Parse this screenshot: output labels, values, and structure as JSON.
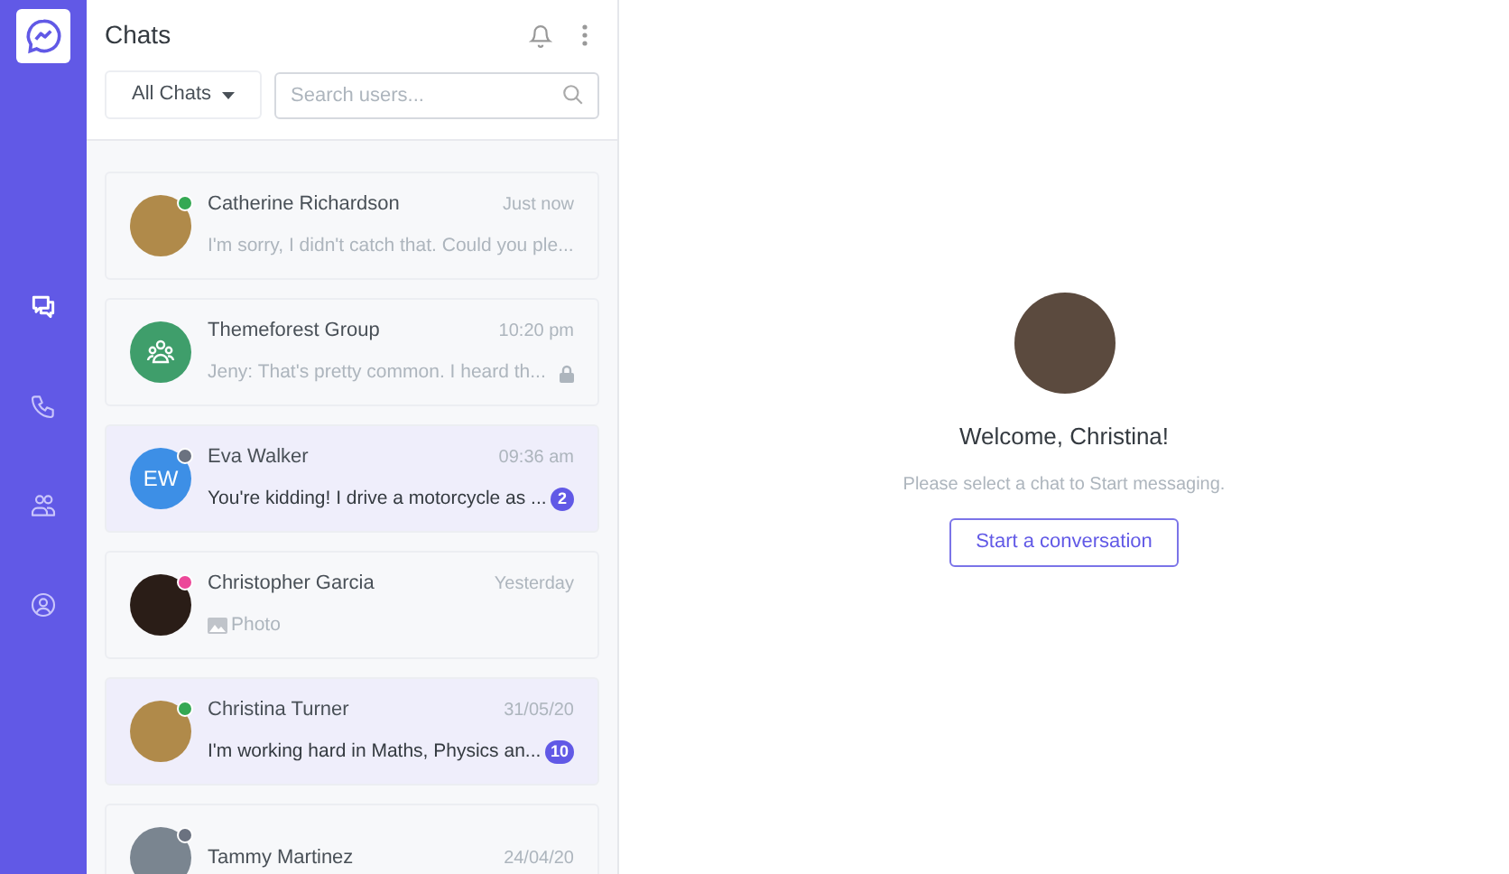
{
  "nav": [
    {
      "selected": true
    },
    {
      "selected": false
    },
    {
      "selected": false
    },
    {
      "selected": false
    }
  ],
  "header": {
    "title": "Chats",
    "filter": "All Chats",
    "search": {
      "placeholder": "Search users..."
    }
  },
  "chats": [
    {
      "name": "Catherine Richardson",
      "time": "Just now",
      "kind": "photo",
      "color": "#34a853",
      "unread": false,
      "message": {
        "kind": "text",
        "text": "I'm sorry, I didn't catch that. Could you ple..."
      }
    },
    {
      "name": "Themeforest Group",
      "time": "10:20 pm",
      "kind": "group",
      "unread": false,
      "locked": true,
      "message": {
        "kind": "text",
        "text": "Jeny: That's pretty common. I heard th..."
      }
    },
    {
      "name": "Eva Walker",
      "time": "09:36 am",
      "kind": "initials",
      "initials": "EW",
      "color": "#6b7280",
      "unread": true,
      "badge": "2",
      "message": {
        "kind": "text",
        "text": "You're kidding! I drive a motorcycle as ..."
      }
    },
    {
      "name": "Christopher Garcia",
      "time": "Yesterday",
      "kind": "photo",
      "color": "#ec4899",
      "unread": false,
      "message": {
        "kind": "photo",
        "text": "Photo"
      }
    },
    {
      "name": "Christina Turner",
      "time": "31/05/20",
      "kind": "photo",
      "color": "#34a853",
      "unread": true,
      "badge": "10",
      "message": {
        "kind": "text",
        "text": "I'm working hard in Maths, Physics an..."
      }
    },
    {
      "name": "Tammy Martinez",
      "time": "24/04/20",
      "kind": "photo",
      "color": "#6b7280"
    }
  ],
  "welcome": {
    "title": "Welcome, Christina!",
    "subtitle": "Please select a chat to Start messaging.",
    "button": "Start a conversation"
  }
}
